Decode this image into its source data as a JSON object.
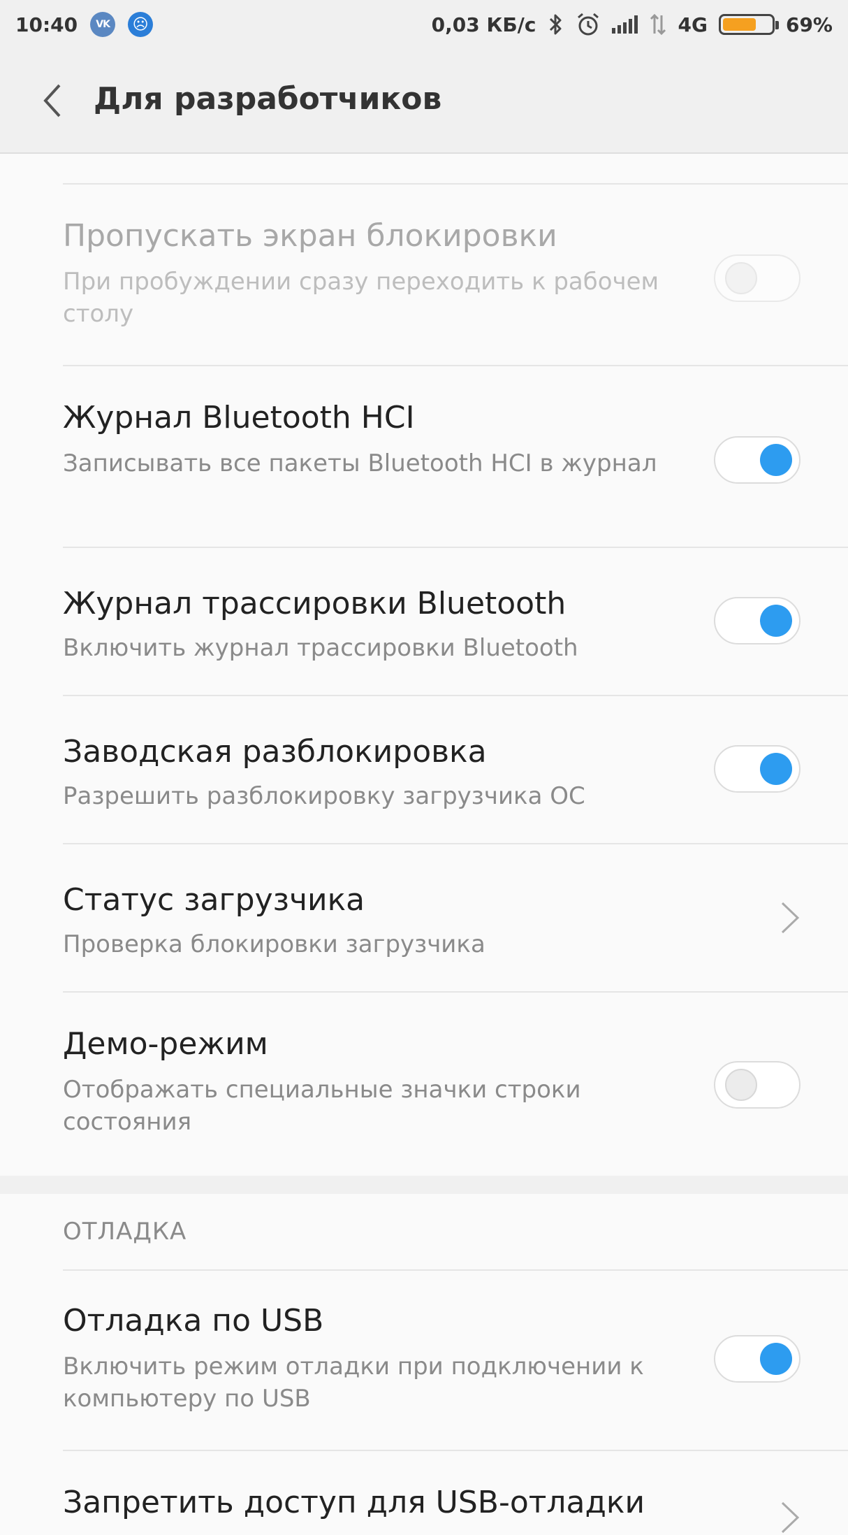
{
  "status_bar": {
    "time": "10:40",
    "vk_icon_text": "VK",
    "speed": "0,03 КБ/с",
    "network": "4G",
    "battery_text": "69%",
    "battery_level": 0.69,
    "battery_color": "#f5a020"
  },
  "header": {
    "title": "Для разработчиков"
  },
  "settings": [
    {
      "title": "Пропускать экран блокировки",
      "subtitle": "При пробуждении сразу переходить к рабочем столу",
      "toggle": "off",
      "enabled": false
    },
    {
      "title": "Журнал Bluetooth HCI",
      "subtitle": "Записывать все пакеты Bluetooth HCI в журнал",
      "toggle": "on",
      "enabled": true
    },
    {
      "title": "Журнал трассировки Bluetooth",
      "subtitle": "Включить журнал трассировки Bluetooth",
      "toggle": "on",
      "enabled": true
    },
    {
      "title": "Заводская разблокировка",
      "subtitle": "Разрешить разблокировку загрузчика ОС",
      "toggle": "on",
      "enabled": true
    },
    {
      "title": "Статус загрузчика",
      "subtitle": "Проверка блокировки загрузчика",
      "control": "chevron",
      "enabled": true
    },
    {
      "title": "Демо-режим",
      "subtitle": "Отображать специальные значки строки состояния",
      "toggle": "off",
      "enabled": true
    }
  ],
  "debug_section": {
    "header": "ОТЛАДКА",
    "items": [
      {
        "title": "Отладка по USB",
        "subtitle": "Включить режим отладки при подключении к компьютеру по USB",
        "toggle": "on",
        "enabled": true
      },
      {
        "title": "Запретить доступ для USB-отладки",
        "control": "chevron",
        "enabled": true
      }
    ]
  },
  "colors": {
    "accent": "#2d9cf0",
    "background": "#fafafa",
    "header_bg": "#f0f0f0"
  }
}
